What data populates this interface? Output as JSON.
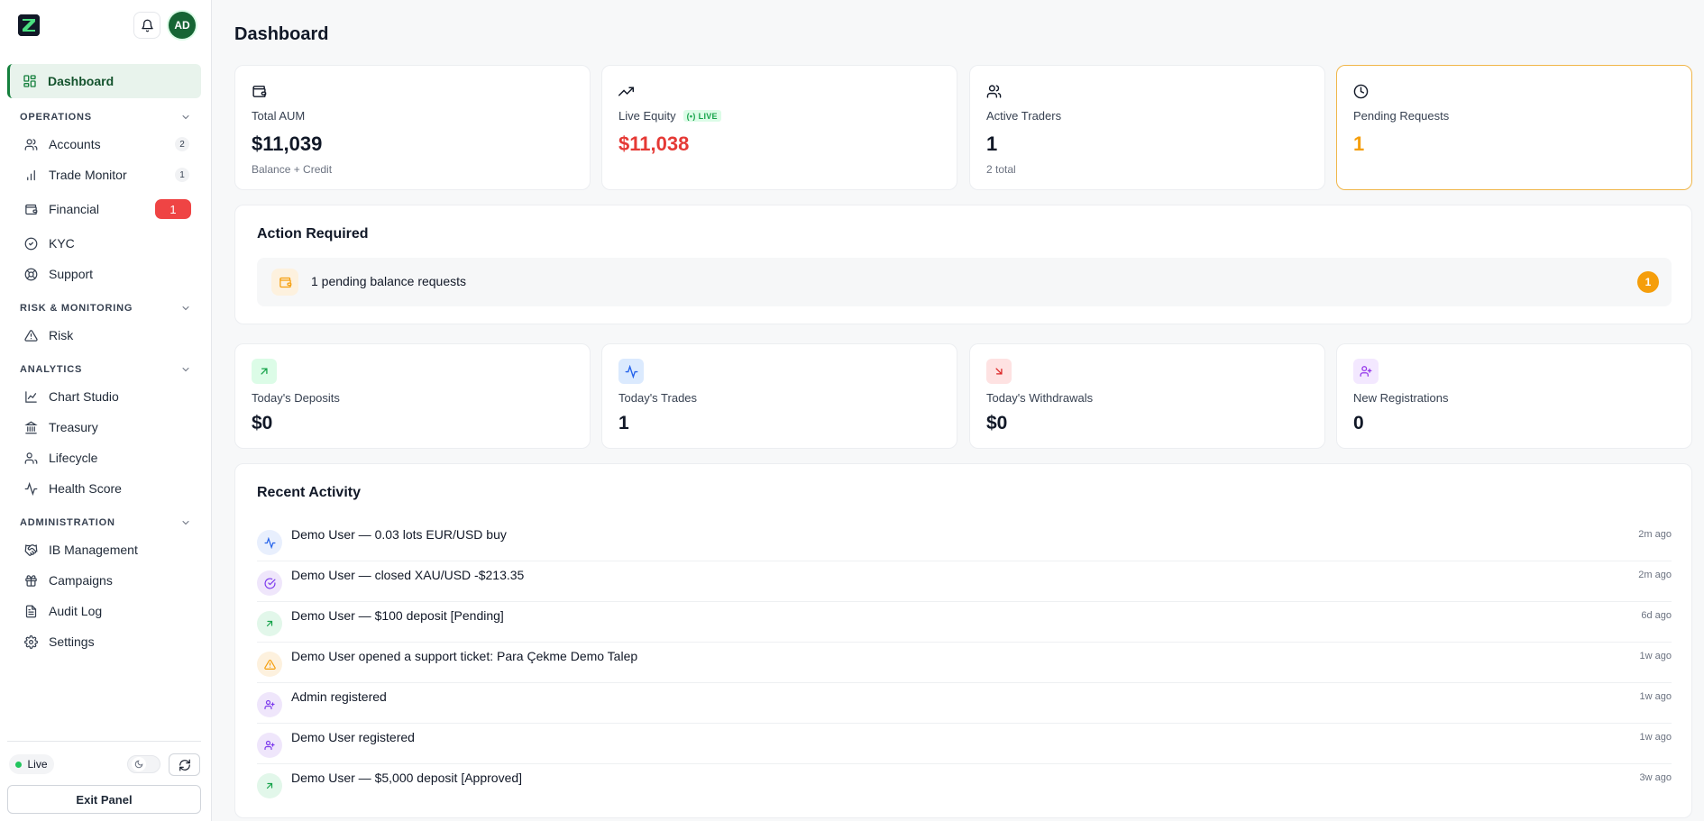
{
  "app": {
    "logo_letter": "Z"
  },
  "header": {
    "avatar_initials": "AD"
  },
  "sidebar": {
    "dashboard_label": "Dashboard",
    "sections": {
      "operations": "OPERATIONS",
      "risk": "RISK & MONITORING",
      "analytics": "ANALYTICS",
      "administration": "ADMINISTRATION"
    },
    "items": {
      "accounts": {
        "label": "Accounts",
        "count": "2"
      },
      "trade_monitor": {
        "label": "Trade Monitor",
        "count": "1"
      },
      "financial": {
        "label": "Financial",
        "count": "1"
      },
      "kyc": {
        "label": "KYC"
      },
      "support": {
        "label": "Support"
      },
      "risk": {
        "label": "Risk"
      },
      "chart_studio": {
        "label": "Chart Studio"
      },
      "treasury": {
        "label": "Treasury"
      },
      "lifecycle": {
        "label": "Lifecycle"
      },
      "health_score": {
        "label": "Health Score"
      },
      "ib_management": {
        "label": "IB Management"
      },
      "campaigns": {
        "label": "Campaigns"
      },
      "audit_log": {
        "label": "Audit Log"
      },
      "settings": {
        "label": "Settings"
      }
    },
    "footer": {
      "status_label": "Live",
      "exit_label": "Exit Panel"
    }
  },
  "main": {
    "title": "Dashboard",
    "stats": {
      "total_aum": {
        "label": "Total AUM",
        "value": "$11,039",
        "sub": "Balance + Credit"
      },
      "live_equity": {
        "label": "Live Equity",
        "badge": "LIVE",
        "value": "$11,038"
      },
      "active_traders": {
        "label": "Active Traders",
        "value": "1",
        "sub": "2 total"
      },
      "pending_requests": {
        "label": "Pending Requests",
        "value": "1"
      }
    },
    "action_required": {
      "title": "Action Required",
      "item_text": "1 pending balance requests",
      "item_count": "1"
    },
    "today": {
      "deposits": {
        "label": "Today's Deposits",
        "value": "$0"
      },
      "trades": {
        "label": "Today's Trades",
        "value": "1"
      },
      "withdrawals": {
        "label": "Today's Withdrawals",
        "value": "$0"
      },
      "registrations": {
        "label": "New Registrations",
        "value": "0"
      }
    },
    "recent_activity": {
      "title": "Recent Activity",
      "items": [
        {
          "text": "Demo User — 0.03 lots EUR/USD buy",
          "time": "2m ago",
          "icon": "activity-icon"
        },
        {
          "text": "Demo User — closed XAU/USD -$213.35",
          "time": "2m ago",
          "icon": "check-circle-icon"
        },
        {
          "text": "Demo User — $100 deposit [Pending]",
          "time": "6d ago",
          "icon": "arrow-up-right-icon"
        },
        {
          "text": "Demo User opened a support ticket: Para Çekme Demo Talep",
          "time": "1w ago",
          "icon": "alert-triangle-icon"
        },
        {
          "text": "Admin registered",
          "time": "1w ago",
          "icon": "user-plus-icon"
        },
        {
          "text": "Demo User registered",
          "time": "1w ago",
          "icon": "user-plus-icon"
        },
        {
          "text": "Demo User — $5,000 deposit [Approved]",
          "time": "3w ago",
          "icon": "arrow-up-right-icon"
        }
      ]
    }
  },
  "colors": {
    "brand_green": "#15803d",
    "danger_red": "#ef4444",
    "equity_red": "#e53935",
    "pending_amber": "#f59e0b"
  }
}
